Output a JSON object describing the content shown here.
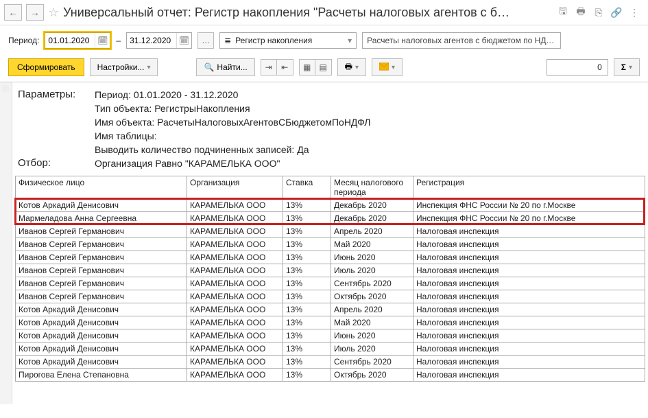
{
  "title": "Универсальный отчет: Регистр накопления \"Расчеты налоговых агентов с б…",
  "period": {
    "label": "Период:",
    "from": "01.01.2020",
    "to": "31.12.2020",
    "sep": "–"
  },
  "type_select": {
    "value": "Регистр накопления"
  },
  "object_select": {
    "value": "Расчеты налоговых агентов с бюджетом по НДФЛ"
  },
  "actions": {
    "form": "Сформировать",
    "settings": "Настройки...",
    "find": "Найти...",
    "sum": "Σ",
    "sum_value": "0"
  },
  "params": {
    "heading": "Параметры:",
    "period": "Период: 01.01.2020 - 31.12.2020",
    "obj_type": "Тип объекта: РегистрыНакопления",
    "obj_name": "Имя объекта: РасчетыНалоговыхАгентовСБюджетомПоНДФЛ",
    "tbl_name": "Имя таблицы:",
    "subcount": "Выводить количество подчиненных записей: Да",
    "filter_label": "Отбор:",
    "filter": "Организация Равно \"КАРАМЕЛЬКА ООО\""
  },
  "columns": {
    "c1": "Физическое лицо",
    "c2": "Организация",
    "c3": "Ставка",
    "c4": "Месяц налогового периода",
    "c5": "Регистрация"
  },
  "rows": [
    {
      "p": "Котов Аркадий Денисович",
      "o": "КАРАМЕЛЬКА ООО",
      "r": "13%",
      "m": "Декабрь 2020",
      "reg": "Инспекция ФНС России № 20 по г.Москве"
    },
    {
      "p": "Мармеладова Анна Сергеевна",
      "o": "КАРАМЕЛЬКА ООО",
      "r": "13%",
      "m": "Декабрь 2020",
      "reg": "Инспекция ФНС России № 20 по г.Москве"
    },
    {
      "p": "Иванов Сергей Германович",
      "o": "КАРАМЕЛЬКА ООО",
      "r": "13%",
      "m": "Апрель 2020",
      "reg": "Налоговая инспекция"
    },
    {
      "p": "Иванов Сергей Германович",
      "o": "КАРАМЕЛЬКА ООО",
      "r": "13%",
      "m": "Май 2020",
      "reg": "Налоговая инспекция"
    },
    {
      "p": "Иванов Сергей Германович",
      "o": "КАРАМЕЛЬКА ООО",
      "r": "13%",
      "m": "Июнь 2020",
      "reg": "Налоговая инспекция"
    },
    {
      "p": "Иванов Сергей Германович",
      "o": "КАРАМЕЛЬКА ООО",
      "r": "13%",
      "m": "Июль 2020",
      "reg": "Налоговая инспекция"
    },
    {
      "p": "Иванов Сергей Германович",
      "o": "КАРАМЕЛЬКА ООО",
      "r": "13%",
      "m": "Сентябрь 2020",
      "reg": "Налоговая инспекция"
    },
    {
      "p": "Иванов Сергей Германович",
      "o": "КАРАМЕЛЬКА ООО",
      "r": "13%",
      "m": "Октябрь 2020",
      "reg": "Налоговая инспекция"
    },
    {
      "p": "Котов Аркадий Денисович",
      "o": "КАРАМЕЛЬКА ООО",
      "r": "13%",
      "m": "Апрель 2020",
      "reg": "Налоговая инспекция"
    },
    {
      "p": "Котов Аркадий Денисович",
      "o": "КАРАМЕЛЬКА ООО",
      "r": "13%",
      "m": "Май 2020",
      "reg": "Налоговая инспекция"
    },
    {
      "p": "Котов Аркадий Денисович",
      "o": "КАРАМЕЛЬКА ООО",
      "r": "13%",
      "m": "Июнь 2020",
      "reg": "Налоговая инспекция"
    },
    {
      "p": "Котов Аркадий Денисович",
      "o": "КАРАМЕЛЬКА ООО",
      "r": "13%",
      "m": "Июль 2020",
      "reg": "Налоговая инспекция"
    },
    {
      "p": "Котов Аркадий Денисович",
      "o": "КАРАМЕЛЬКА ООО",
      "r": "13%",
      "m": "Сентябрь 2020",
      "reg": "Налоговая инспекция"
    },
    {
      "p": "Пирогова Елена Степановна",
      "o": "КАРАМЕЛЬКА ООО",
      "r": "13%",
      "m": "Октябрь 2020",
      "reg": "Налоговая инспекция"
    }
  ]
}
